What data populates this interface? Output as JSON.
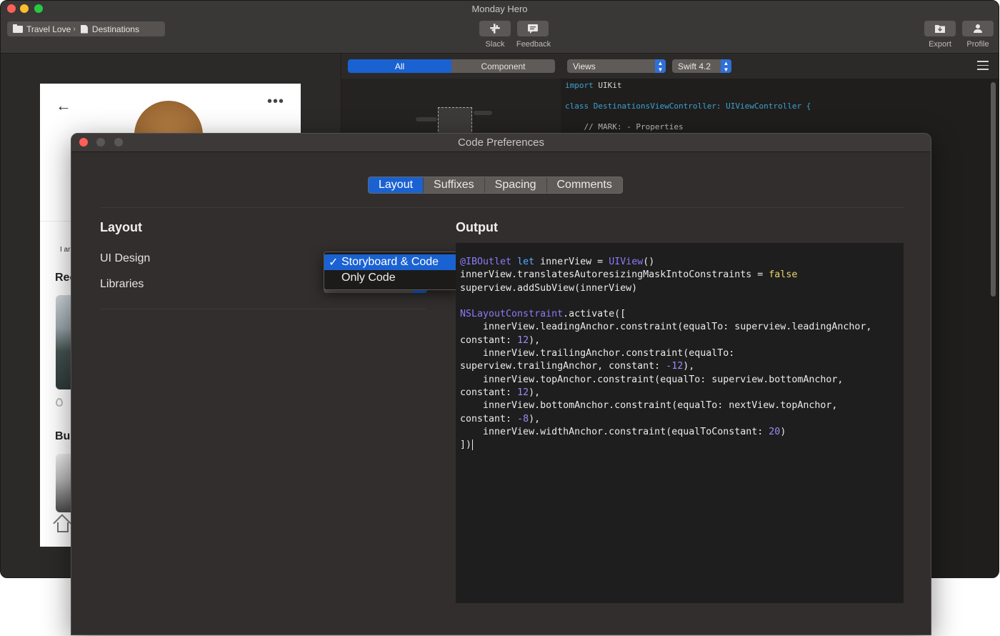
{
  "main_window": {
    "title": "Monday Hero",
    "breadcrumb": {
      "project": "Travel Love",
      "separator": "›",
      "screen": "Destinations"
    },
    "toolbar": {
      "slack_label": "Slack",
      "feedback_label": "Feedback",
      "export_label": "Export",
      "profile_label": "Profile"
    },
    "preview": {
      "dots": "•••",
      "small_text": "I ar",
      "heading1": "Rec",
      "heading2": "Bu"
    },
    "segments": [
      "All",
      "Component"
    ],
    "active_segment": "All",
    "code_toolbar": {
      "views_select": "Views",
      "swift_select": "Swift 4.2"
    },
    "code_lines": [
      {
        "a": "import",
        "b": " UIKit"
      },
      {
        "a": "class",
        "b": " DestinationsViewController: UIViewController {"
      },
      {
        "a": "",
        "b": "    // MARK: - Properties"
      }
    ]
  },
  "dialog": {
    "title": "Code Preferences",
    "tabs": [
      "Layout",
      "Suffixes",
      "Spacing",
      "Comments"
    ],
    "active_tab": "Layout",
    "layout_heading": "Layout",
    "rows": {
      "ui_design": "UI Design",
      "libraries": "Libraries"
    },
    "dropdown": {
      "options": [
        "Storyboard & Code",
        "Only Code"
      ],
      "selected": "Storyboard & Code",
      "checkmark": "✓"
    },
    "output_heading": "Output",
    "output_code": [
      "@IBOutlet let innerView = UIView()",
      "innerView.translatesAutoresizingMaskIntoConstraints = false",
      "superview.addSubView(innerView)",
      "",
      "NSLayoutConstraint.activate([",
      "    innerView.leadingAnchor.constraint(equalTo: superview.leadingAnchor,",
      "constant: 12),",
      "    innerView.trailingAnchor.constraint(equalTo:",
      "superview.trailingAnchor, constant: -12),",
      "    innerView.topAnchor.constraint(equalTo: superview.bottomAnchor,",
      "constant: 12),",
      "    innerView.bottomAnchor.constraint(equalTo: nextView.topAnchor,",
      "constant: -8),",
      "    innerView.widthAnchor.constraint(equalToConstant: 20)",
      "])"
    ]
  },
  "colors": {
    "accent": "#1a62d2",
    "traffic_red": "#fe5f57",
    "traffic_yellow": "#febc2e",
    "traffic_green": "#28c840",
    "traffic_inactive": "#5a5856"
  }
}
